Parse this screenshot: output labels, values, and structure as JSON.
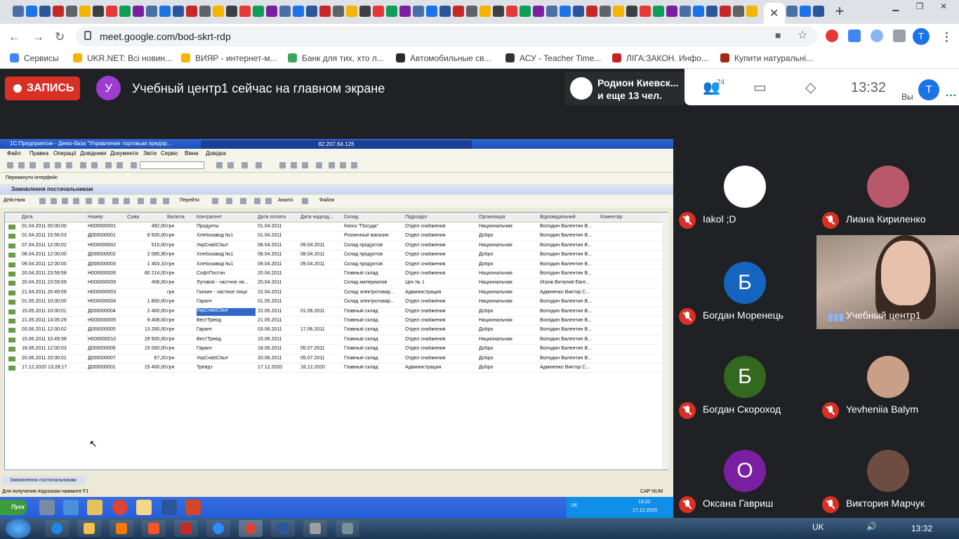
{
  "browser": {
    "url": "meet.google.com/bod-skrt-rdp",
    "profile_initial": "T",
    "tab_close": "✕",
    "new_tab": "+"
  },
  "bookmarks": [
    {
      "label": "Сервисы",
      "color": "#4285f4"
    },
    {
      "label": "UKR.NET: Всі новин...",
      "color": "#f4b400"
    },
    {
      "label": "ВИЯР - интернет-м...",
      "color": "#f4b400"
    },
    {
      "label": "Банк для тих, хто л...",
      "color": "#3aa757"
    },
    {
      "label": "Автомобильные св...",
      "color": "#2a2a2a"
    },
    {
      "label": "АСУ - Teacher Time...",
      "color": "#333333"
    },
    {
      "label": "ЛІГА:ЗАКОН. Инфо...",
      "color": "#c5221f"
    },
    {
      "label": "Купити натуральні...",
      "color": "#a52714"
    }
  ],
  "meet": {
    "record_label": "ЗАПИСЬ",
    "presenter_initial": "У",
    "presenter_text": "Учебный центр1 сейчас на главном экране",
    "host_line1": "Родион Киевск...",
    "host_line2": "и еще 13 чел.",
    "participant_count": "24",
    "time": "13:32",
    "you_label": "Вы",
    "you_initial": "T",
    "accent": "#1a73e8"
  },
  "app": {
    "title": "1С:Предприятие - Демо-база \"Управление торговым предпр...",
    "rdp_host": "82.207.64.126",
    "menu": [
      "Файл",
      "Правка",
      "Операції",
      "Довідники",
      "Документи",
      "Звіти",
      "Сервіс",
      "Вікна",
      "Довідка"
    ],
    "interface_switch": "Перемкнути інтерфейс",
    "doc_title": "Замовлення постачальникам",
    "actions_label": "Действия",
    "goto_label": "Перейти",
    "analysis_label": "Аналіз",
    "files_label": "Файли",
    "columns": [
      "Дата",
      "Номер",
      "Сума",
      "Валюта",
      "Контрагент",
      "Дата оплати",
      "Дата надход...",
      "Склад",
      "Підрозділ",
      "Організація",
      "Відповідальний",
      "Коментар"
    ],
    "rows": [
      [
        "01.04.2011 00:00:00",
        "Н000000001",
        "492,00",
        "грн",
        "Продукты",
        "01.04.2011",
        "",
        "Киоск \"Посуда\"",
        "Отдел снабжения",
        "Национальная",
        "Володин Валентин В..."
      ],
      [
        "01.04.2011 15:56:03",
        "Д000000001",
        "8 500,00",
        "грн",
        "Хлебозавод №1",
        "01.04.2011",
        "",
        "Розничный магазин",
        "Отдел снабжения",
        "Добро",
        "Володин Валентин В..."
      ],
      [
        "07.04.2011 12:00:02",
        "Н000000002",
        "510,00",
        "грн",
        "УкрСнабСбыт",
        "08.04.2011",
        "09.04.2011",
        "Склад продуктов",
        "Отдел снабжения",
        "Национальная",
        "Володин Валентин В..."
      ],
      [
        "08.04.2011 12:00:00",
        "Д000000002",
        "2 085,90",
        "грн",
        "Хлебозавод №1",
        "08.04.2011",
        "08.04.2011",
        "Склад продуктов",
        "Отдел снабжения",
        "Добро",
        "Володин Валентин В..."
      ],
      [
        "09.04.2011 12:00:00",
        "Д000000003",
        "1 403,10",
        "грн",
        "Хлебозавод №1",
        "09.04.2011",
        "09.04.2011",
        "Склад продуктов",
        "Отдел снабжения",
        "Добро",
        "Володин Валентин В..."
      ],
      [
        "20.04.2011 23:59:58",
        "Н000000006",
        "80 214,00",
        "грн",
        "СофтПостач",
        "20.04.2011",
        "",
        "Главный склад",
        "Отдел снабжения",
        "Национальная",
        "Володин Валентин В..."
      ],
      [
        "20.04.2011 23:59:59",
        "Н000000009",
        "408,00",
        "грн",
        "Луговой - частное ли...",
        "20.04.2011",
        "",
        "Склад материалов",
        "Цех № 1",
        "Национальная",
        "Игров Виталий Евге..."
      ],
      [
        "21.04.2011 20:49:09",
        "Н000000003",
        "",
        "грн",
        "Галкин - частное лицо",
        "22.04.2011",
        "",
        "Склад электротовар...",
        "Администрация",
        "Национальная",
        "Адміненко Виктор С..."
      ],
      [
        "01.05.2011 10:00:00",
        "Н000000004",
        "1 800,00",
        "грн",
        "Гарант",
        "01.05.2011",
        "",
        "Склад электротовар...",
        "Отдел снабжения",
        "Национальная",
        "Володин Валентин В..."
      ],
      [
        "15.05.2011 10:00:01",
        "Д000000004",
        "2 400,00",
        "грн",
        "УкрСнабСбыт",
        "22.05.2011",
        "01.06.2011",
        "Главный склад",
        "Отдел снабжения",
        "Добро",
        "Володин Валентин В..."
      ],
      [
        "21.05.2011 14:05:29",
        "Н000000005",
        "9 408,00",
        "грн",
        "ВестТрейд",
        "21.05.2011",
        "",
        "Главный склад",
        "Отдел снабжения",
        "Национальная",
        "Володин Валентин В..."
      ],
      [
        "03.06.2011 12:00:02",
        "Д000000005",
        "13 200,00",
        "грн",
        "Гарант",
        "03.06.2011",
        "17.06.2011",
        "Главный склад",
        "Отдел снабжения",
        "Добро",
        "Володин Валентин В..."
      ],
      [
        "15.06.2011 10:49:38",
        "Н000000010",
        "29 500,00",
        "грн",
        "ВестТрейд",
        "15.06.2011",
        "",
        "Главный склад",
        "Отдел снабжения",
        "Национальная",
        "Володин Валентин В..."
      ],
      [
        "18.06.2011 12:00:03",
        "Д000000006",
        "15 000,00",
        "грн",
        "Гарант",
        "18.06.2011",
        "05.07.2011",
        "Главный склад",
        "Отдел снабжения",
        "Добро",
        "Володин Валентин В..."
      ],
      [
        "20.06.2011 20:00:01",
        "Д000000007",
        "67,20",
        "грн",
        "УкрСнабСбыт",
        "20.06.2011",
        "05.07.2011",
        "Главный склад",
        "Отдел снабжения",
        "Добро",
        "Володин Валентин В..."
      ],
      [
        "17.12.2020 13:28:17",
        "Д000000001",
        "15 400,00",
        "грн",
        "Трейд+",
        "17.12.2020",
        "18.12.2020",
        "Главный склад",
        "Администрация",
        "Добро",
        "Адміненко Виктор С..."
      ]
    ],
    "selected_row": 9,
    "selected_col": 4,
    "grid_tab": "Замовлення постачальникам",
    "status_hint": "Для получения подсказки нажмите F1",
    "caps": "CAP   NUM",
    "xp_start": "Пуск",
    "xp_lang": "UK",
    "xp_time": "13:32",
    "xp_date": "17.12.2020"
  },
  "participants": [
    {
      "name": "Iakol ;D",
      "initial": "",
      "color": "#ffffff",
      "muted": true
    },
    {
      "name": "Лиана Кириленко",
      "initial": "",
      "color": "#b9586a",
      "muted": true
    },
    {
      "name": "Богдан Моренець",
      "initial": "Б",
      "color": "#1565c0",
      "muted": true
    },
    {
      "name": "Учебный центр1",
      "initial": "",
      "color": "",
      "muted": false
    },
    {
      "name": "Богдан Скороход",
      "initial": "Б",
      "color": "#33691e",
      "muted": true
    },
    {
      "name": "Yevheniia Balym",
      "initial": "",
      "color": "#c9a087",
      "muted": true
    },
    {
      "name": "Оксана Гавриш",
      "initial": "О",
      "color": "#7b1fa2",
      "muted": true
    },
    {
      "name": "Виктория Марчук",
      "initial": "",
      "color": "#6d4c41",
      "muted": true
    }
  ],
  "taskbar": {
    "lang": "UK",
    "time": "13:32"
  }
}
